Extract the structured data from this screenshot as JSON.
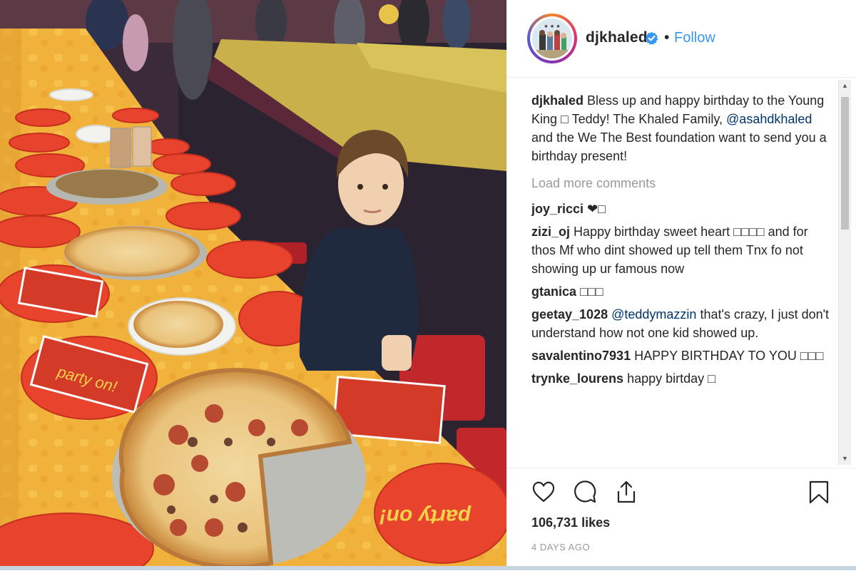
{
  "post": {
    "username": "djkhaled",
    "follow_label": "Follow",
    "follow_separator": "•",
    "caption_user": "djkhaled",
    "caption_text_1": " Bless up and happy birthday to the Young King ",
    "caption_emoji": "□",
    "caption_text_2": " Teddy! The Khaled Family, ",
    "caption_mention": "@asahdkhaled",
    "caption_text_3": " and the We The Best foundation want to send you a birthday present!",
    "load_more_label": "Load more comments",
    "comments": [
      {
        "user": "joy_ricci",
        "pre": " ❤□",
        "mention": "",
        "post": ""
      },
      {
        "user": "zizi_oj",
        "pre": " Happy birthday sweet heart □□□□ and for thos Mf who dint showed up tell them Tnx fo not showing up ur famous now",
        "mention": "",
        "post": ""
      },
      {
        "user": "gtanica",
        "pre": " □□□",
        "mention": "",
        "post": ""
      },
      {
        "user": "geetay_1028",
        "pre": " ",
        "mention": "@teddymazzin",
        "post": " that's crazy, I just don't understand how not one kid showed up."
      },
      {
        "user": "savalentino7931",
        "pre": " HAPPY BIRTHDAY TO YOU □□□",
        "mention": "",
        "post": ""
      },
      {
        "user": "trynke_lourens",
        "pre": " happy birtday □",
        "mention": "",
        "post": ""
      }
    ],
    "likes": "106,731 likes",
    "time": "4 DAYS AGO"
  },
  "photo": {
    "plate_text": "party on!"
  },
  "icons": {
    "avatar": "avatar",
    "verified": "verified-badge-icon",
    "like": "heart-icon",
    "comment": "comment-bubble-icon",
    "share": "share-icon",
    "save": "bookmark-icon",
    "scroll_up": "chevron-up-icon",
    "scroll_down": "chevron-down-icon"
  },
  "colors": {
    "follow": "#3897f0",
    "verified": "#3897f0",
    "text": "#262626",
    "muted": "#999999",
    "mention": "#003569"
  }
}
